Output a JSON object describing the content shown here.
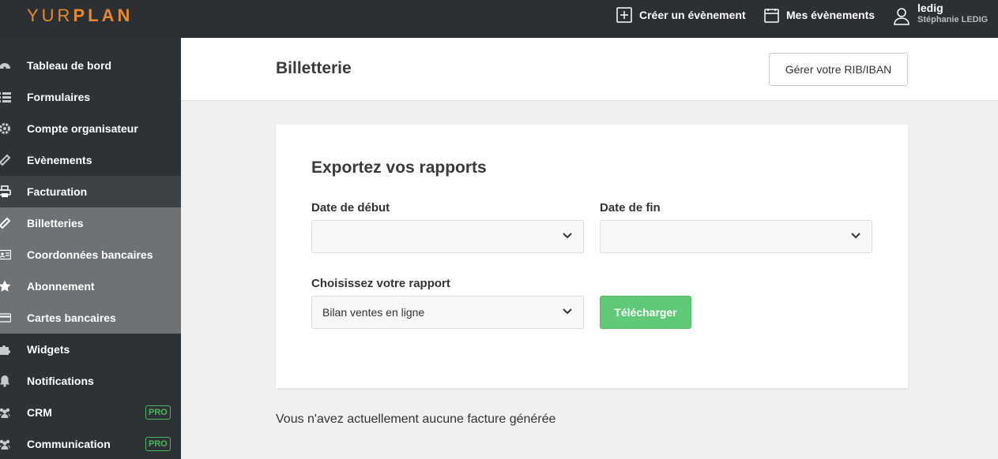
{
  "brand": {
    "logo_light": "YUR",
    "logo_bold": "PLAN",
    "accent": "#e8892b"
  },
  "topbar": {
    "create_event": "Créer un évènement",
    "my_events": "Mes évènements",
    "user_login": "ledig",
    "user_full_name": "Stéphanie LEDIG"
  },
  "sidebar": {
    "items": [
      {
        "label": "Tableau de bord",
        "icon": "dashboard-icon"
      },
      {
        "label": "Formulaires",
        "icon": "list-icon"
      },
      {
        "label": "Compte organisateur",
        "icon": "gear-icon"
      },
      {
        "label": "Evènements",
        "icon": "ticket-icon"
      },
      {
        "label": "Facturation",
        "icon": "printer-icon",
        "state": "active"
      },
      {
        "label": "Billetteries",
        "icon": "ticket-icon",
        "state": "sub-active"
      },
      {
        "label": "Coordonnées bancaires",
        "icon": "id-card-icon",
        "state": "sub"
      },
      {
        "label": "Abonnement",
        "icon": "star-icon",
        "state": "sub"
      },
      {
        "label": "Cartes bancaires",
        "icon": "credit-card-icon",
        "state": "sub"
      },
      {
        "label": "Widgets",
        "icon": "puzzle-icon"
      },
      {
        "label": "Notifications",
        "icon": "bell-icon"
      },
      {
        "label": "CRM",
        "icon": "users-icon",
        "badge": "PRO"
      },
      {
        "label": "Communication",
        "icon": "users-icon",
        "badge": "PRO"
      }
    ]
  },
  "header": {
    "title": "Billetterie",
    "rib_button": "Gérer votre RIB/IBAN"
  },
  "export": {
    "title": "Exportez vos rapports",
    "start_label": "Date de début",
    "start_value": "",
    "end_label": "Date de fin",
    "end_value": "",
    "report_label": "Choisissez votre rapport",
    "report_value": "Bilan ventes en ligne",
    "download_button": "Télécharger"
  },
  "no_invoice_text": "Vous n'avez actuellement aucune facture générée",
  "colors": {
    "topbar": "#2c2f33",
    "sidebar": "#2c3235",
    "pro_badge": "#4cb85c",
    "download": "#5fc978"
  }
}
